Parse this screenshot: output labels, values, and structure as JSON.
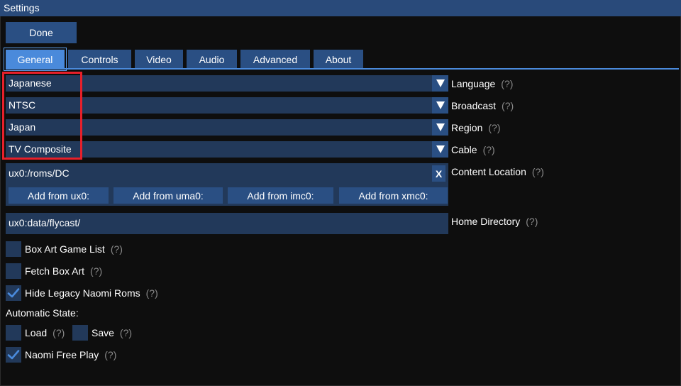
{
  "window": {
    "title": "Settings"
  },
  "done_label": "Done",
  "tabs": [
    {
      "label": "General",
      "active": true
    },
    {
      "label": "Controls"
    },
    {
      "label": "Video"
    },
    {
      "label": "Audio"
    },
    {
      "label": "Advanced"
    },
    {
      "label": "About"
    }
  ],
  "help_marker": "(?)",
  "combos": [
    {
      "value": "Japanese",
      "label": "Language"
    },
    {
      "value": "NTSC",
      "label": "Broadcast"
    },
    {
      "value": "Japan",
      "label": "Region"
    },
    {
      "value": "TV Composite",
      "label": "Cable"
    }
  ],
  "content": {
    "path": "ux0:/roms/DC",
    "remove_label": "X",
    "label": "Content Location",
    "add_buttons": [
      "Add from ux0:",
      "Add from uma0:",
      "Add from imc0:",
      "Add from xmc0:"
    ]
  },
  "home": {
    "value": "ux0:data/flycast/",
    "label": "Home Directory"
  },
  "checkboxes": [
    {
      "label": "Box Art Game List",
      "checked": false
    },
    {
      "label": "Fetch Box Art",
      "checked": false
    },
    {
      "label": "Hide Legacy Naomi Roms",
      "checked": true
    }
  ],
  "autostate": {
    "heading": "Automatic State:",
    "load": {
      "label": "Load",
      "checked": false
    },
    "save": {
      "label": "Save",
      "checked": false
    }
  },
  "free_play": {
    "label": "Naomi Free Play",
    "checked": true
  },
  "colors": {
    "accent": "#4a8adb",
    "button": "#2a4f83",
    "field": "#22395a",
    "highlight": "#e8202a"
  }
}
